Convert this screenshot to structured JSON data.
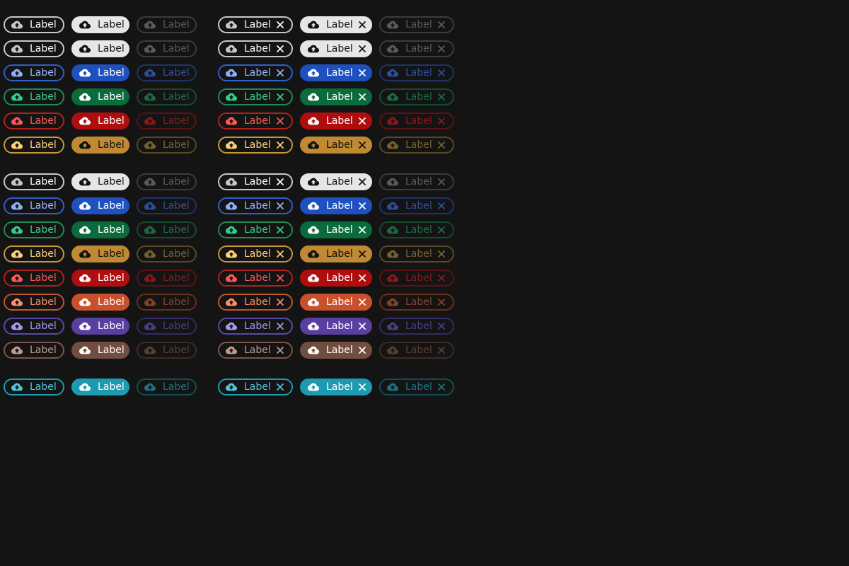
{
  "chip_label": "Label",
  "icons": {
    "leading": "cloud-upload-icon",
    "trailing": "close-icon"
  },
  "variants": [
    {
      "kind": "outline",
      "removable": false
    },
    {
      "kind": "filled",
      "removable": false
    },
    {
      "kind": "outline-disabled",
      "removable": false
    },
    {
      "kind": "outline",
      "removable": true
    },
    {
      "kind": "filled",
      "removable": true
    },
    {
      "kind": "outline-disabled",
      "removable": true
    }
  ],
  "palettes": {
    "default": {
      "border": "#c8c8c8",
      "text": "#ffffff",
      "icon": "#c8c8c8",
      "fill": "#e6e6e6",
      "fill_text": "#111111",
      "dis_border": "#3c3c3c",
      "dis_text": "#5a5a5a"
    },
    "blue": {
      "border": "#2f5fc8",
      "text": "#9ab5ff",
      "icon": "#8fb0ff",
      "fill": "#1f50c0",
      "fill_text": "#ffffff",
      "dis_border": "#1e3566",
      "dis_text": "#2c4e9c"
    },
    "green": {
      "border": "#1f8a55",
      "text": "#3ad08a",
      "icon": "#2fd08a",
      "fill": "#0a6b3d",
      "fill_text": "#ffffff",
      "dis_border": "#154a32",
      "dis_text": "#1c6a45"
    },
    "red": {
      "border": "#b31f1f",
      "text": "#ff5a5a",
      "icon": "#ff5a5a",
      "fill": "#b00e0e",
      "fill_text": "#ffffff",
      "dis_border": "#5c1212",
      "dis_text": "#8a1818"
    },
    "yellow": {
      "border": "#c9963a",
      "text": "#ffd27a",
      "icon": "#ffd27a",
      "fill": "#c08a35",
      "fill_text": "#111111",
      "dis_border": "#5b4822",
      "dis_text": "#7a6030"
    },
    "orange": {
      "border": "#c2552b",
      "text": "#ff8f68",
      "icon": "#ff8f68",
      "fill": "#c8502c",
      "fill_text": "#ffffff",
      "dis_border": "#6a3018",
      "dis_text": "#8a4026"
    },
    "purple": {
      "border": "#5a48a8",
      "text": "#a997f0",
      "icon": "#a997f0",
      "fill": "#5a3ea0",
      "fill_text": "#ffffff",
      "dis_border": "#352a63",
      "dis_text": "#4a3c88"
    },
    "brown": {
      "border": "#7b5646",
      "text": "#c49b8b",
      "icon": "#c49b8b",
      "fill": "#714e40",
      "fill_text": "#ffffff",
      "dis_border": "#3e2b23",
      "dis_text": "#5a3e33"
    },
    "cyan": {
      "border": "#1f9bb2",
      "text": "#53c6dc",
      "icon": "#53c6dc",
      "fill": "#1c9ab0",
      "fill_text": "#ffffff",
      "dis_border": "#134c58",
      "dis_text": "#1e7083"
    }
  },
  "rows": [
    {
      "palette": "default"
    },
    {
      "palette": "default"
    },
    {
      "palette": "blue"
    },
    {
      "palette": "green"
    },
    {
      "palette": "red"
    },
    {
      "palette": "yellow"
    },
    {
      "palette": "default"
    },
    {
      "palette": "blue"
    },
    {
      "palette": "green"
    },
    {
      "palette": "yellow"
    },
    {
      "palette": "red"
    },
    {
      "palette": "orange"
    },
    {
      "palette": "purple"
    },
    {
      "palette": "brown"
    },
    {
      "palette": "cyan"
    }
  ]
}
